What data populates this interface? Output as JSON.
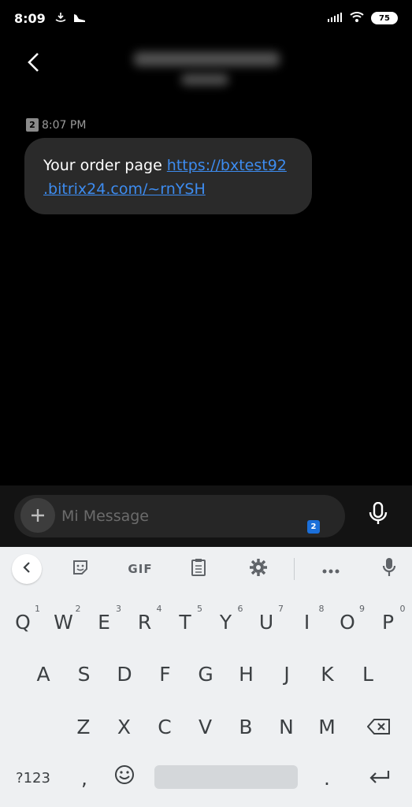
{
  "status_bar": {
    "time": "8:09",
    "battery": "75"
  },
  "message": {
    "sim": "2",
    "time": "8:07 PM",
    "text": "Your order page ",
    "link_line1": "https://bxtest92",
    "link_line2": ".bitrix24.com/~rnYSH"
  },
  "composer": {
    "placeholder": "Mi Message",
    "sim": "2"
  },
  "keyboard": {
    "toolbar": {
      "gif": "GIF"
    },
    "row1": [
      {
        "k": "Q",
        "h": "1"
      },
      {
        "k": "W",
        "h": "2"
      },
      {
        "k": "E",
        "h": "3"
      },
      {
        "k": "R",
        "h": "4"
      },
      {
        "k": "T",
        "h": "5"
      },
      {
        "k": "Y",
        "h": "6"
      },
      {
        "k": "U",
        "h": "7"
      },
      {
        "k": "I",
        "h": "8"
      },
      {
        "k": "O",
        "h": "9"
      },
      {
        "k": "P",
        "h": "0"
      }
    ],
    "row2": [
      "A",
      "S",
      "D",
      "F",
      "G",
      "H",
      "J",
      "K",
      "L"
    ],
    "row3": [
      "Z",
      "X",
      "C",
      "V",
      "B",
      "N",
      "M"
    ],
    "symbols": "?123",
    "comma": ",",
    "period": "."
  },
  "colors": {
    "link": "#3d8cf0",
    "bubble": "#2a2a2a",
    "accent": "#1b6fd9"
  }
}
